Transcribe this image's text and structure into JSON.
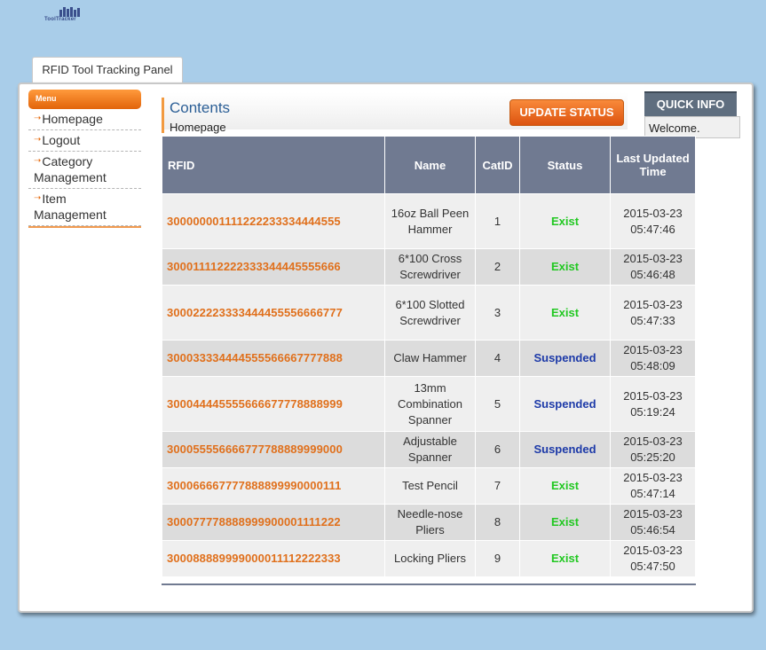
{
  "logo": {
    "brand_text": "ToolTracker"
  },
  "panel": {
    "tab_label": "RFID Tool Tracking Panel"
  },
  "menu": {
    "header": "Menu",
    "items": [
      {
        "label": "Homepage"
      },
      {
        "label": "Logout"
      },
      {
        "label": "Category Management"
      },
      {
        "label": "Item Management"
      }
    ]
  },
  "content": {
    "title": "Contents",
    "subtitle": "Homepage",
    "update_button": "UPDATE STATUS"
  },
  "quick_info": {
    "title": "QUICK INFO",
    "text": "Welcome."
  },
  "table": {
    "columns": [
      "RFID",
      "Name",
      "CatID",
      "Status",
      "Last Updated Time"
    ],
    "rows": [
      {
        "rfid": "300000001111222233334444555",
        "name": "16oz Ball Peen Hammer",
        "catid": "1",
        "status": "Exist",
        "date": "2015-03-23",
        "time": "05:47:46"
      },
      {
        "rfid": "300011112222333344445555666",
        "name": "6*100 Cross Screwdriver",
        "catid": "2",
        "status": "Exist",
        "date": "2015-03-23",
        "time": "05:46:48"
      },
      {
        "rfid": "300022223333444455556666777",
        "name": "6*100 Slotted Screwdriver",
        "catid": "3",
        "status": "Exist",
        "date": "2015-03-23",
        "time": "05:47:33"
      },
      {
        "rfid": "300033334444555566667777888",
        "name": "Claw Hammer",
        "catid": "4",
        "status": "Suspended",
        "date": "2015-03-23",
        "time": "05:48:09"
      },
      {
        "rfid": "300044445555666677778888999",
        "name": "13mm Combination Spanner",
        "catid": "5",
        "status": "Suspended",
        "date": "2015-03-23",
        "time": "05:19:24"
      },
      {
        "rfid": "300055556666777788889999000",
        "name": "Adjustable Spanner",
        "catid": "6",
        "status": "Suspended",
        "date": "2015-03-23",
        "time": "05:25:20"
      },
      {
        "rfid": "300066667777888899990000111",
        "name": "Test Pencil",
        "catid": "7",
        "status": "Exist",
        "date": "2015-03-23",
        "time": "05:47:14"
      },
      {
        "rfid": "300077778888999900001111222",
        "name": "Needle-nose Pliers",
        "catid": "8",
        "status": "Exist",
        "date": "2015-03-23",
        "time": "05:46:54"
      },
      {
        "rfid": "300088889999000011112222333",
        "name": "Locking Pliers",
        "catid": "9",
        "status": "Exist",
        "date": "2015-03-23",
        "time": "05:47:50"
      }
    ]
  },
  "colors": {
    "background": "#a9cde9",
    "accent_orange": "#e2640a",
    "table_header": "#707a91",
    "status_exist": "#22c822",
    "status_suspended": "#1d3aa8",
    "rfid_text": "#e0701c"
  },
  "icons": {
    "menu_bullet": "arrow-icon",
    "logo": "tool-rack-icon"
  }
}
